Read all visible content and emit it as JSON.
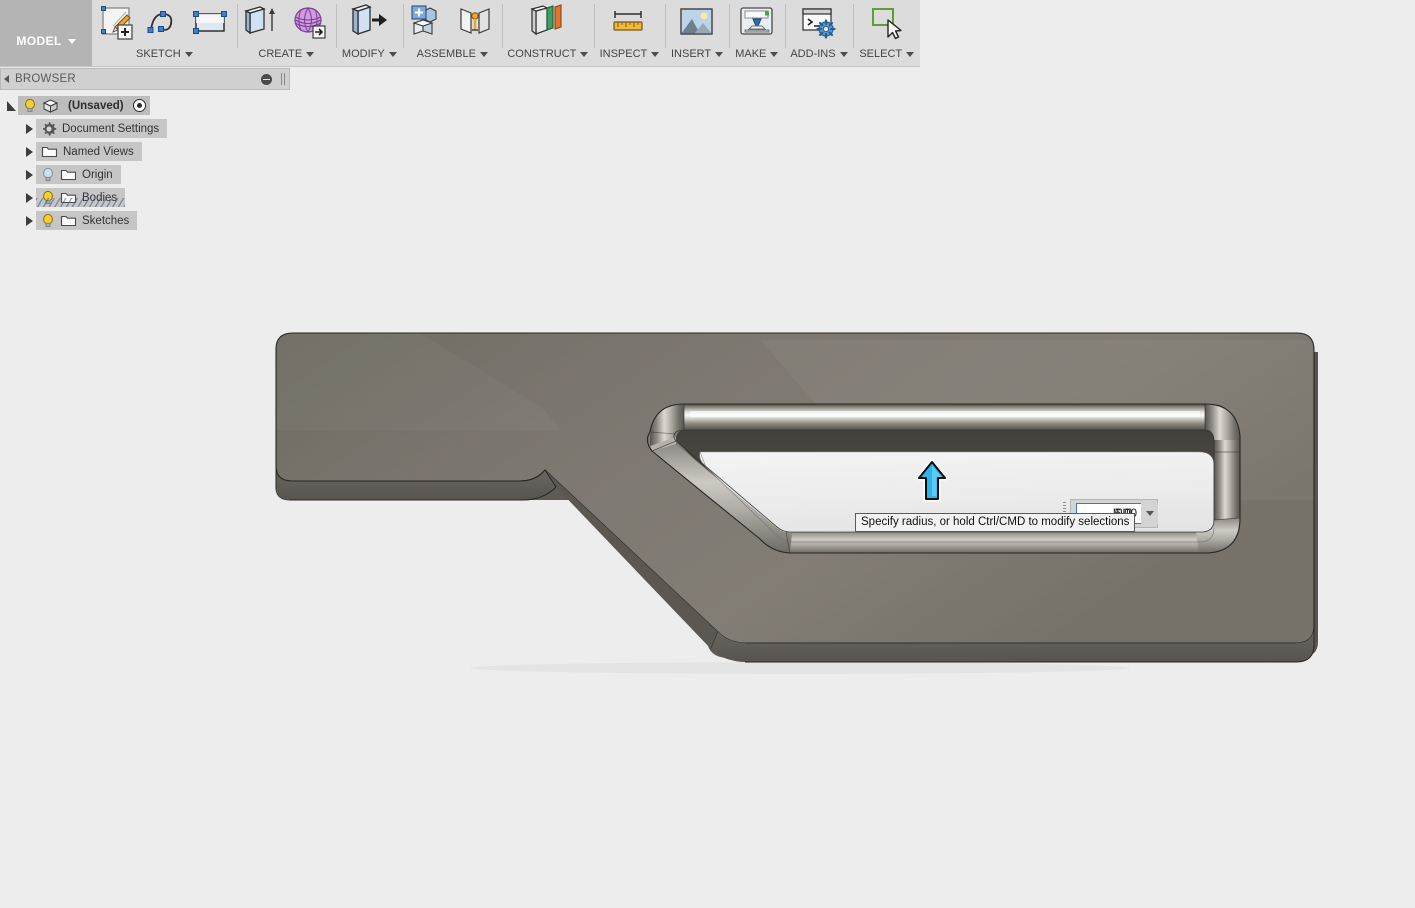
{
  "app": {
    "workspace_tab": "MODEL",
    "background_color": "#ededed"
  },
  "toolbar": {
    "panels": [
      {
        "label": "SKETCH",
        "icons": [
          "create-sketch-icon",
          "sketch-spline-icon",
          "sketch-rectangle-icon"
        ]
      },
      {
        "label": "CREATE",
        "icons": [
          "extrude-icon",
          "create-form-icon"
        ]
      },
      {
        "label": "MODIFY",
        "icons": [
          "press-pull-icon"
        ]
      },
      {
        "label": "ASSEMBLE",
        "icons": [
          "new-component-icon",
          "joint-icon"
        ]
      },
      {
        "label": "CONSTRUCT",
        "icons": [
          "offset-plane-icon"
        ]
      },
      {
        "label": "INSPECT",
        "icons": [
          "measure-icon"
        ]
      },
      {
        "label": "INSERT",
        "icons": [
          "insert-image-icon"
        ]
      },
      {
        "label": "MAKE",
        "icons": [
          "3d-print-icon"
        ]
      },
      {
        "label": "ADD-INS",
        "icons": [
          "scripts-addins-icon"
        ]
      },
      {
        "label": "SELECT",
        "icons": [
          "select-cursor-icon"
        ]
      }
    ]
  },
  "browser": {
    "title": "BROWSER",
    "collapse_icon": "collapse-left-arrow-icon",
    "minimize_icon": "minus-circle-icon",
    "grip_icon": "drag-grip-icon",
    "tree": [
      {
        "label": "(Unsaved)",
        "depth": 0,
        "expanded": true,
        "has_bulb": true,
        "bulb_on": true,
        "icon": "component-cube-icon",
        "has_radio": true,
        "hatched": false
      },
      {
        "label": "Document Settings",
        "depth": 1,
        "expanded": false,
        "has_bulb": false,
        "bulb_on": false,
        "icon": "gear-icon",
        "has_radio": false,
        "hatched": false
      },
      {
        "label": "Named Views",
        "depth": 1,
        "expanded": false,
        "has_bulb": false,
        "bulb_on": false,
        "icon": "folder-icon",
        "has_radio": false,
        "hatched": false
      },
      {
        "label": "Origin",
        "depth": 1,
        "expanded": false,
        "has_bulb": true,
        "bulb_on": false,
        "icon": "folder-icon",
        "has_radio": false,
        "hatched": false
      },
      {
        "label": "Bodies",
        "depth": 1,
        "expanded": false,
        "has_bulb": true,
        "bulb_on": true,
        "icon": "folder-icon",
        "has_radio": false,
        "hatched": true
      },
      {
        "label": "Sketches",
        "depth": 1,
        "expanded": false,
        "has_bulb": true,
        "bulb_on": true,
        "icon": "folder-icon",
        "has_radio": false,
        "hatched": false
      }
    ]
  },
  "fillet_hud": {
    "tooltip": "Specify radius, or hold Ctrl/CMD to modify selections",
    "radius_value": "6.00",
    "unit": "mm",
    "unit_dropdown_icon": "chevron-down-icon",
    "manipulator_icon": "up-arrow-manipulator-icon",
    "manipulator_color": "#1fa8e0"
  },
  "model": {
    "body_color_top": "#7b766c",
    "body_color_side": "#5d5a53",
    "fillet_highlight": "#d8d6d0",
    "edge_color": "#2a2a2a"
  }
}
